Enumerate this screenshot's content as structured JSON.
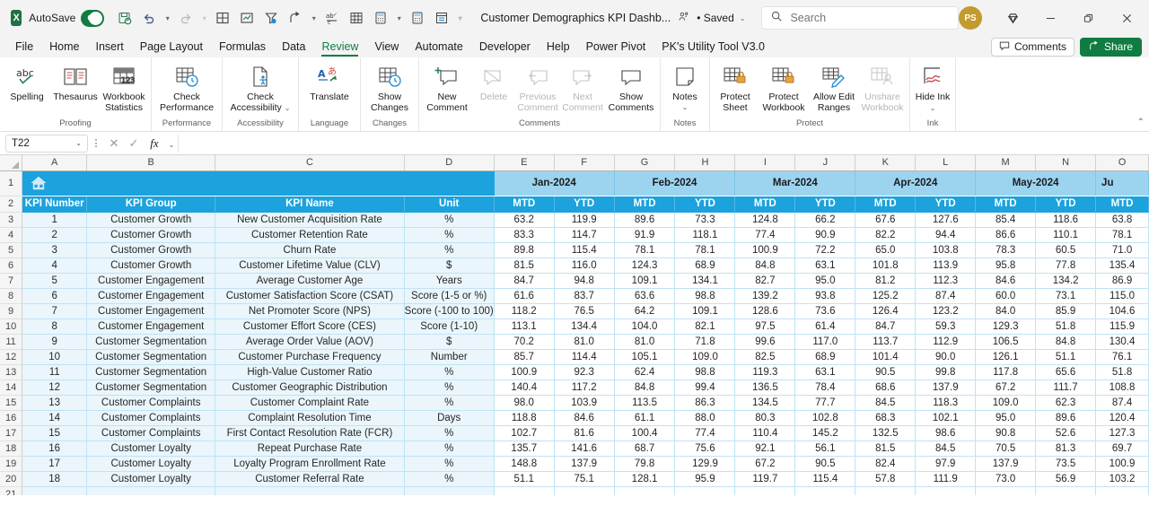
{
  "titlebar": {
    "app_logo": "excel-logo",
    "autosave_label": "AutoSave",
    "autosave_state": "On",
    "document_title": "Customer Demographics KPI Dashb...",
    "save_state": "• Saved",
    "search_placeholder": "Search",
    "avatar_initials": "PS",
    "quick_access": [
      {
        "name": "save-icon",
        "label": "Save"
      },
      {
        "name": "undo-icon",
        "label": "Undo"
      },
      {
        "name": "redo-icon",
        "label": "Redo"
      },
      {
        "name": "borders-icon",
        "label": "Borders"
      },
      {
        "name": "insert-chart-icon",
        "label": "Insert Chart"
      },
      {
        "name": "filter-icon",
        "label": "Filter"
      },
      {
        "name": "share-arrow-icon",
        "label": "Share"
      },
      {
        "name": "spelling-icon",
        "label": "Spelling"
      },
      {
        "name": "pivot-table-icon",
        "label": "PivotTable"
      },
      {
        "name": "calculator-icon",
        "label": "Calculator"
      },
      {
        "name": "calculator2-icon",
        "label": "Calculate Now"
      },
      {
        "name": "form-icon",
        "label": "Form"
      },
      {
        "name": "customize-qat-icon",
        "label": "Customize Quick Access Toolbar"
      }
    ],
    "window_buttons": [
      "minimize",
      "restore",
      "close"
    ]
  },
  "tabs": [
    {
      "label": "File",
      "active": false
    },
    {
      "label": "Home",
      "active": false
    },
    {
      "label": "Insert",
      "active": false
    },
    {
      "label": "Page Layout",
      "active": false
    },
    {
      "label": "Formulas",
      "active": false
    },
    {
      "label": "Data",
      "active": false
    },
    {
      "label": "Review",
      "active": true
    },
    {
      "label": "View",
      "active": false
    },
    {
      "label": "Automate",
      "active": false
    },
    {
      "label": "Developer",
      "active": false
    },
    {
      "label": "Help",
      "active": false
    },
    {
      "label": "Power Pivot",
      "active": false
    },
    {
      "label": "PK's Utility Tool V3.0",
      "active": false
    }
  ],
  "tabs_right": {
    "comments_label": "Comments",
    "share_label": "Share"
  },
  "ribbon": {
    "groups": [
      {
        "label": "Proofing",
        "items": [
          {
            "label": "Spelling",
            "icon": "spelling-abc-icon",
            "disabled": false,
            "dropdown": false
          },
          {
            "label": "Thesaurus",
            "icon": "thesaurus-book-icon",
            "disabled": false,
            "dropdown": false
          },
          {
            "label": "Workbook Statistics",
            "icon": "workbook-statistics-icon",
            "disabled": false,
            "dropdown": false
          }
        ]
      },
      {
        "label": "Performance",
        "items": [
          {
            "label": "Check Performance",
            "icon": "check-performance-icon",
            "disabled": false,
            "dropdown": false
          }
        ]
      },
      {
        "label": "Accessibility",
        "items": [
          {
            "label": "Check Accessibility",
            "icon": "check-accessibility-icon",
            "disabled": false,
            "dropdown": true
          }
        ]
      },
      {
        "label": "Language",
        "items": [
          {
            "label": "Translate",
            "icon": "translate-icon",
            "disabled": false,
            "dropdown": false
          }
        ]
      },
      {
        "label": "Changes",
        "items": [
          {
            "label": "Show Changes",
            "icon": "show-changes-icon",
            "disabled": false,
            "dropdown": false
          }
        ]
      },
      {
        "label": "Comments",
        "items": [
          {
            "label": "New Comment",
            "icon": "new-comment-icon",
            "disabled": false,
            "dropdown": false
          },
          {
            "label": "Delete",
            "icon": "delete-comment-icon",
            "disabled": true,
            "dropdown": false
          },
          {
            "label": "Previous Comment",
            "icon": "previous-comment-icon",
            "disabled": true,
            "dropdown": false
          },
          {
            "label": "Next Comment",
            "icon": "next-comment-icon",
            "disabled": true,
            "dropdown": false
          },
          {
            "label": "Show Comments",
            "icon": "show-comments-icon",
            "disabled": false,
            "dropdown": false
          }
        ]
      },
      {
        "label": "Notes",
        "items": [
          {
            "label": "Notes",
            "icon": "notes-icon",
            "disabled": false,
            "dropdown": true
          }
        ]
      },
      {
        "label": "Protect",
        "items": [
          {
            "label": "Protect Sheet",
            "icon": "protect-sheet-icon",
            "disabled": false,
            "dropdown": false
          },
          {
            "label": "Protect Workbook",
            "icon": "protect-workbook-icon",
            "disabled": false,
            "dropdown": false
          },
          {
            "label": "Allow Edit Ranges",
            "icon": "allow-edit-ranges-icon",
            "disabled": false,
            "dropdown": false
          },
          {
            "label": "Unshare Workbook",
            "icon": "unshare-workbook-icon",
            "disabled": true,
            "dropdown": false
          }
        ]
      },
      {
        "label": "Ink",
        "items": [
          {
            "label": "Hide Ink",
            "icon": "hide-ink-icon",
            "disabled": false,
            "dropdown": true
          }
        ]
      }
    ]
  },
  "formula_bar": {
    "name_box": "T22",
    "formula_value": "",
    "cancel_icon": "cancel-icon",
    "enter_icon": "enter-icon",
    "fx_icon": "insert-function-icon"
  },
  "sheet": {
    "column_letters": [
      "A",
      "B",
      "C",
      "D",
      "E",
      "F",
      "G",
      "H",
      "I",
      "J",
      "K",
      "L",
      "M",
      "N",
      "O"
    ],
    "row_numbers": [
      1,
      2,
      3,
      4,
      5,
      6,
      7,
      8,
      9,
      10,
      11,
      12,
      13,
      14,
      15,
      16,
      17,
      18,
      19,
      20,
      21
    ],
    "banner_icon": "home-icon",
    "month_headers": [
      {
        "label": "Jan-2024",
        "span": 2
      },
      {
        "label": "Feb-2024",
        "span": 2
      },
      {
        "label": "Mar-2024",
        "span": 2
      },
      {
        "label": "Apr-2024",
        "span": 2
      },
      {
        "label": "May-2024",
        "span": 2
      },
      {
        "label": "Ju",
        "span": 1
      }
    ],
    "sub_headers": [
      "MTD",
      "YTD",
      "MTD",
      "YTD",
      "MTD",
      "YTD",
      "MTD",
      "YTD",
      "MTD",
      "YTD",
      "MTD"
    ],
    "left_headers": [
      "KPI Number",
      "KPI Group",
      "KPI Name",
      "Unit"
    ],
    "rows": [
      {
        "num": "1",
        "group": "Customer Growth",
        "name": "New Customer Acquisition Rate",
        "unit": "%",
        "values": [
          "63.2",
          "119.9",
          "89.6",
          "73.3",
          "124.8",
          "66.2",
          "67.6",
          "127.6",
          "85.4",
          "118.6",
          "63.8"
        ]
      },
      {
        "num": "2",
        "group": "Customer Growth",
        "name": "Customer Retention Rate",
        "unit": "%",
        "values": [
          "83.3",
          "114.7",
          "91.9",
          "118.1",
          "77.4",
          "90.9",
          "82.2",
          "94.4",
          "86.6",
          "110.1",
          "78.1"
        ]
      },
      {
        "num": "3",
        "group": "Customer Growth",
        "name": "Churn Rate",
        "unit": "%",
        "values": [
          "89.8",
          "115.4",
          "78.1",
          "78.1",
          "100.9",
          "72.2",
          "65.0",
          "103.8",
          "78.3",
          "60.5",
          "71.0"
        ]
      },
      {
        "num": "4",
        "group": "Customer Growth",
        "name": "Customer Lifetime Value (CLV)",
        "unit": "$",
        "values": [
          "81.5",
          "116.0",
          "124.3",
          "68.9",
          "84.8",
          "63.1",
          "101.8",
          "113.9",
          "95.8",
          "77.8",
          "135.4"
        ]
      },
      {
        "num": "5",
        "group": "Customer Engagement",
        "name": "Average Customer Age",
        "unit": "Years",
        "values": [
          "84.7",
          "94.8",
          "109.1",
          "134.1",
          "82.7",
          "95.0",
          "81.2",
          "112.3",
          "84.6",
          "134.2",
          "86.9"
        ]
      },
      {
        "num": "6",
        "group": "Customer Engagement",
        "name": "Customer Satisfaction Score (CSAT)",
        "unit": "Score (1-5 or %)",
        "values": [
          "61.6",
          "83.7",
          "63.6",
          "98.8",
          "139.2",
          "93.8",
          "125.2",
          "87.4",
          "60.0",
          "73.1",
          "115.0"
        ]
      },
      {
        "num": "7",
        "group": "Customer Engagement",
        "name": "Net Promoter Score (NPS)",
        "unit": "Score (-100 to 100)",
        "values": [
          "118.2",
          "76.5",
          "64.2",
          "109.1",
          "128.6",
          "73.6",
          "126.4",
          "123.2",
          "84.0",
          "85.9",
          "104.6"
        ]
      },
      {
        "num": "8",
        "group": "Customer Engagement",
        "name": "Customer Effort Score (CES)",
        "unit": "Score (1-10)",
        "values": [
          "113.1",
          "134.4",
          "104.0",
          "82.1",
          "97.5",
          "61.4",
          "84.7",
          "59.3",
          "129.3",
          "51.8",
          "115.9"
        ]
      },
      {
        "num": "9",
        "group": "Customer Segmentation",
        "name": "Average Order Value (AOV)",
        "unit": "$",
        "values": [
          "70.2",
          "81.0",
          "81.0",
          "71.8",
          "99.6",
          "117.0",
          "113.7",
          "112.9",
          "106.5",
          "84.8",
          "130.4"
        ]
      },
      {
        "num": "10",
        "group": "Customer Segmentation",
        "name": "Customer Purchase Frequency",
        "unit": "Number",
        "values": [
          "85.7",
          "114.4",
          "105.1",
          "109.0",
          "82.5",
          "68.9",
          "101.4",
          "90.0",
          "126.1",
          "51.1",
          "76.1"
        ]
      },
      {
        "num": "11",
        "group": "Customer Segmentation",
        "name": "High-Value Customer Ratio",
        "unit": "%",
        "values": [
          "100.9",
          "92.3",
          "62.4",
          "98.8",
          "119.3",
          "63.1",
          "90.5",
          "99.8",
          "117.8",
          "65.6",
          "51.8"
        ]
      },
      {
        "num": "12",
        "group": "Customer Segmentation",
        "name": "Customer Geographic Distribution",
        "unit": "%",
        "values": [
          "140.4",
          "117.2",
          "84.8",
          "99.4",
          "136.5",
          "78.4",
          "68.6",
          "137.9",
          "67.2",
          "111.7",
          "108.8"
        ]
      },
      {
        "num": "13",
        "group": "Customer Complaints",
        "name": "Customer Complaint Rate",
        "unit": "%",
        "values": [
          "98.0",
          "103.9",
          "113.5",
          "86.3",
          "134.5",
          "77.7",
          "84.5",
          "118.3",
          "109.0",
          "62.3",
          "87.4"
        ]
      },
      {
        "num": "14",
        "group": "Customer Complaints",
        "name": "Complaint Resolution Time",
        "unit": "Days",
        "values": [
          "118.8",
          "84.6",
          "61.1",
          "88.0",
          "80.3",
          "102.8",
          "68.3",
          "102.1",
          "95.0",
          "89.6",
          "120.4"
        ]
      },
      {
        "num": "15",
        "group": "Customer Complaints",
        "name": "First Contact Resolution Rate (FCR)",
        "unit": "%",
        "values": [
          "102.7",
          "81.6",
          "100.4",
          "77.4",
          "110.4",
          "145.2",
          "132.5",
          "98.6",
          "90.8",
          "52.6",
          "127.3"
        ]
      },
      {
        "num": "16",
        "group": "Customer Loyalty",
        "name": "Repeat Purchase Rate",
        "unit": "%",
        "values": [
          "135.7",
          "141.6",
          "68.7",
          "75.6",
          "92.1",
          "56.1",
          "81.5",
          "84.5",
          "70.5",
          "81.3",
          "69.7"
        ]
      },
      {
        "num": "17",
        "group": "Customer Loyalty",
        "name": "Loyalty Program Enrollment Rate",
        "unit": "%",
        "values": [
          "148.8",
          "137.9",
          "79.8",
          "129.9",
          "67.2",
          "90.5",
          "82.4",
          "97.9",
          "137.9",
          "73.5",
          "100.9"
        ]
      },
      {
        "num": "18",
        "group": "Customer Loyalty",
        "name": "Customer Referral Rate",
        "unit": "%",
        "values": [
          "51.1",
          "75.1",
          "128.1",
          "95.9",
          "119.7",
          "115.4",
          "57.8",
          "111.9",
          "73.0",
          "56.9",
          "103.2"
        ]
      }
    ]
  },
  "colors": {
    "accent": "#1ca2dd",
    "month_header": "#9cd4f0",
    "row_tint": "#eaf6fb",
    "excel_green": "#107c41",
    "grid_line": "#bfe3f5"
  }
}
